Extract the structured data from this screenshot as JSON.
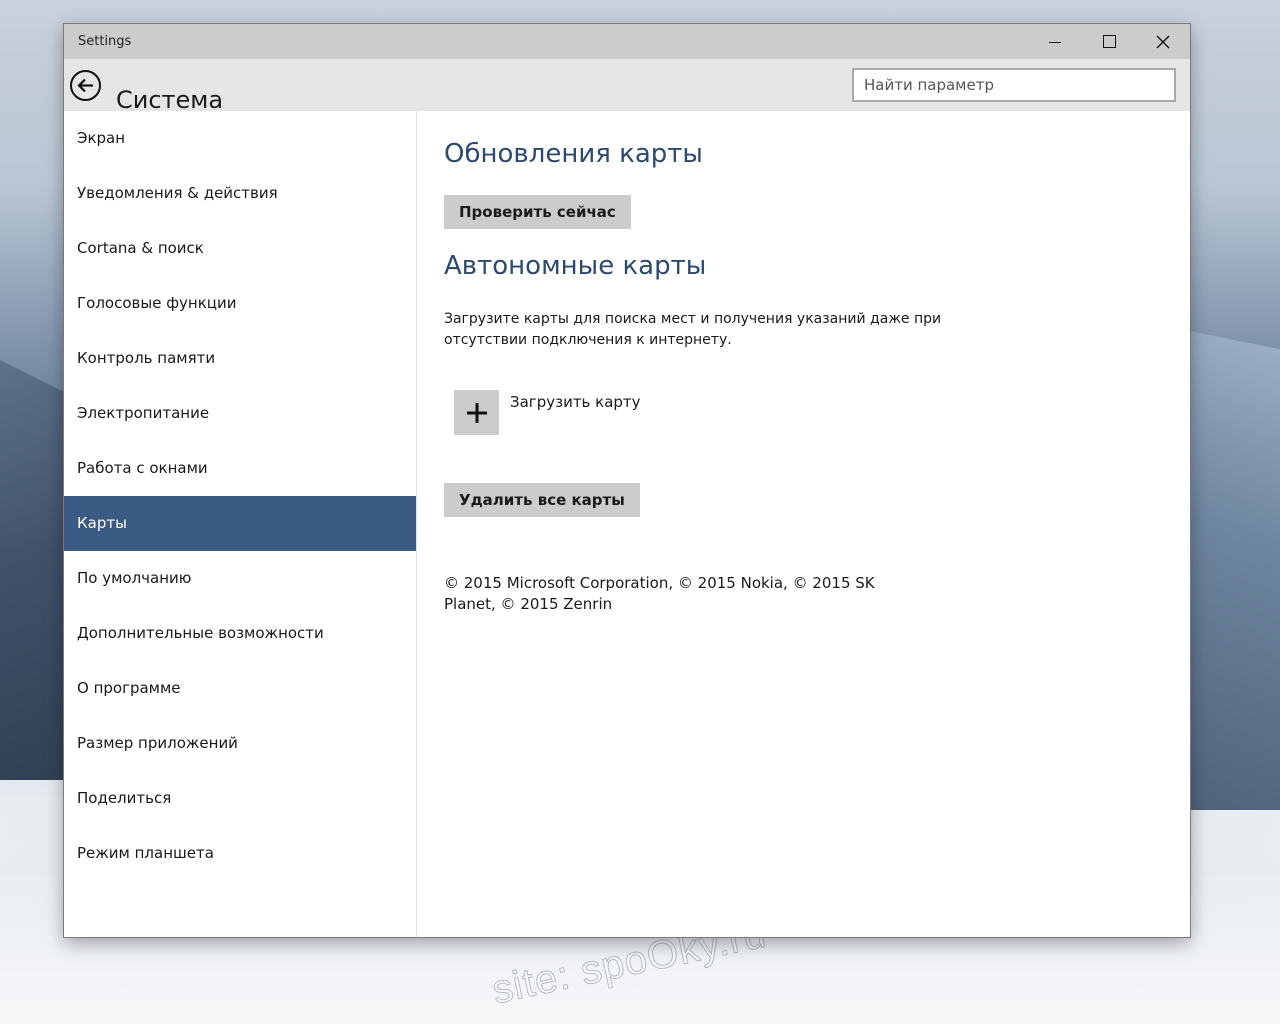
{
  "window": {
    "app_name": "Settings"
  },
  "header": {
    "title": "Система",
    "search_placeholder": "Найти параметр"
  },
  "sidebar": {
    "items": [
      {
        "label": "Экран"
      },
      {
        "label": "Уведомления & действия"
      },
      {
        "label": "Cortana & поиск"
      },
      {
        "label": "Голосовые функции"
      },
      {
        "label": "Контроль памяти"
      },
      {
        "label": "Электропитание"
      },
      {
        "label": "Работа с окнами"
      },
      {
        "label": "Карты",
        "active": true
      },
      {
        "label": "По умолчанию"
      },
      {
        "label": "Дополнительные возможности"
      },
      {
        "label": "О программе"
      },
      {
        "label": "Размер приложений"
      },
      {
        "label": "Поделиться"
      },
      {
        "label": "Режим планшета"
      }
    ]
  },
  "content": {
    "map_updates_title": "Обновления карты",
    "check_now_label": "Проверить сейчас",
    "offline_maps_title": "Автономные карты",
    "offline_description": "Загрузите карты для поиска мест и получения указаний даже при отсутствии подключения к интернету.",
    "download_map_label": "Загрузить карту",
    "delete_all_label": "Удалить все карты",
    "copyright": "© 2015 Microsoft Corporation, © 2015 Nokia, © 2015 SK Planet, © 2015 Zenrin"
  },
  "desktop": {
    "watermark": "site: spoOky.ru"
  },
  "icons": {
    "back": "back-arrow-icon",
    "minimize": "minimize-icon",
    "maximize": "maximize-icon",
    "close": "close-icon",
    "add": "plus-icon"
  },
  "colors": {
    "accent": "#3b5b84",
    "section_title": "#2c4a70",
    "button_bg": "#cccccc",
    "titlebar_bg": "#cccccc",
    "header_bg": "#e6e6e6"
  }
}
